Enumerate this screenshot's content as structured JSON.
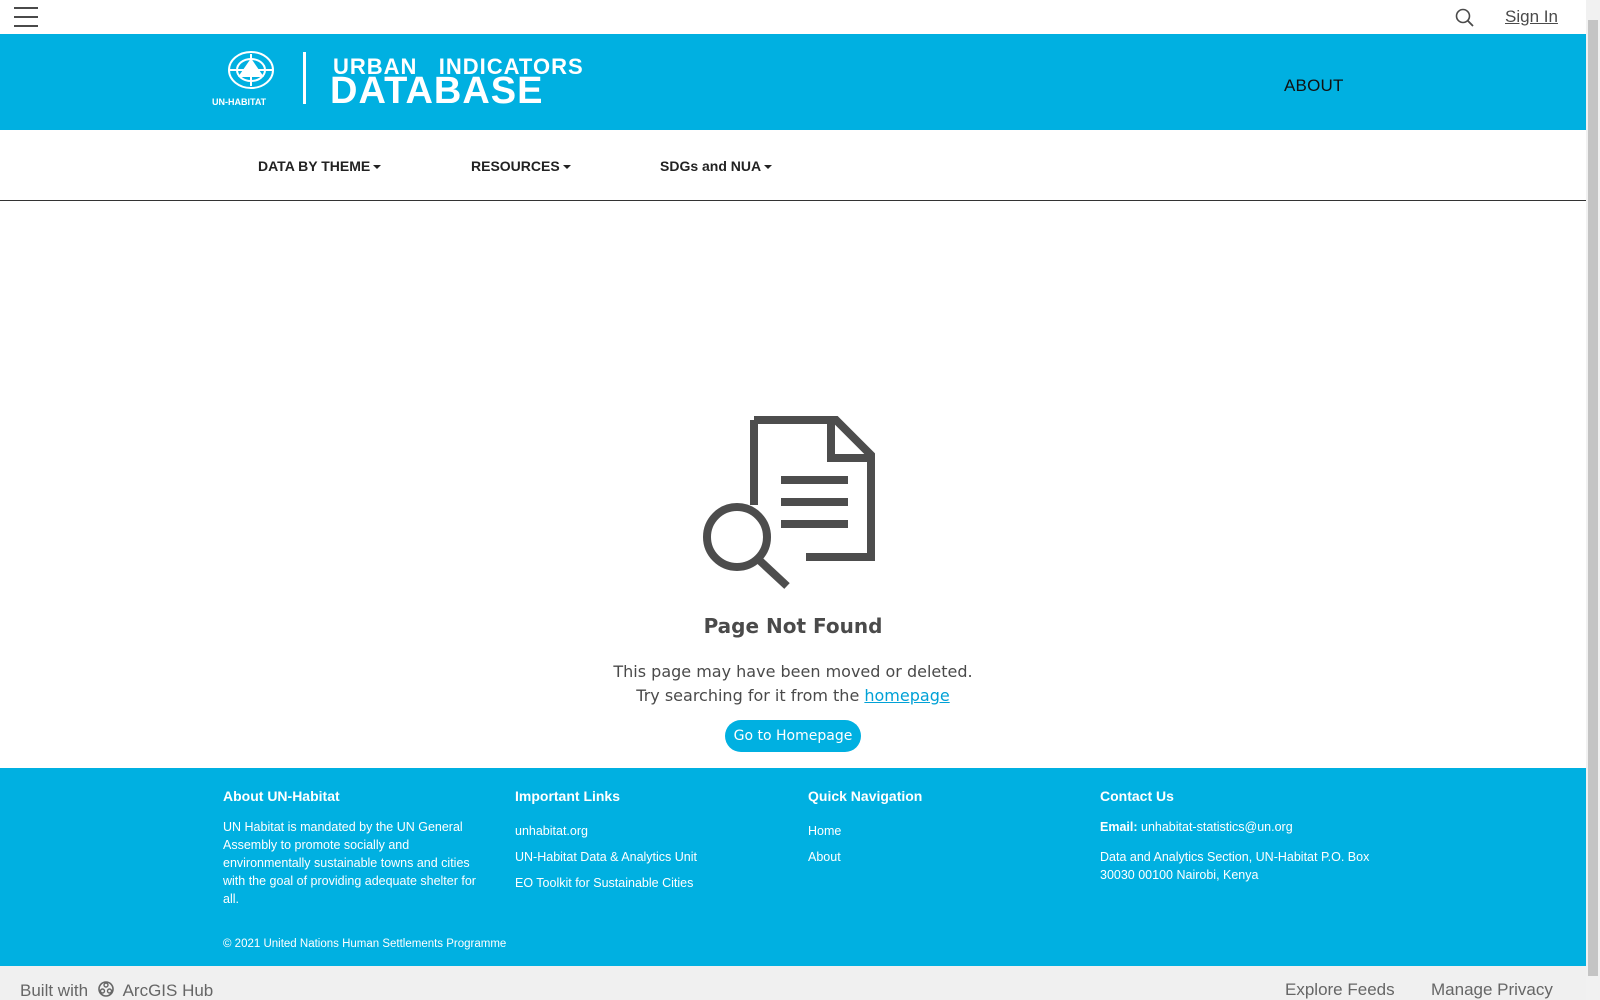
{
  "topbar": {
    "menu_icon": "hamburger-menu-icon",
    "search_icon": "search-icon",
    "sign_in_label": "Sign In"
  },
  "banner": {
    "logo_org": "UN-HABITAT",
    "logo_line1": "URBAN   INDICATORS",
    "logo_line2": "DATABASE",
    "about_label": "ABOUT",
    "bg_color": "#00b0e1"
  },
  "navbar": {
    "items": [
      {
        "label": "DATA BY THEME"
      },
      {
        "label": "RESOURCES"
      },
      {
        "label": "SDGs and NUA"
      }
    ]
  },
  "not_found": {
    "icon": "document-search-icon",
    "title": "Page Not Found",
    "line1": "This page may have been moved or deleted.",
    "line2_prefix": "Try searching for it from the ",
    "line2_link": "homepage",
    "button_label": "Go to Homepage"
  },
  "footer": {
    "about": {
      "heading": "About UN-Habitat",
      "text": "UN Habitat is mandated by the UN General Assembly to promote socially and environmentally sustainable towns and cities with the goal of providing adequate shelter for all."
    },
    "links": {
      "heading": "Important Links",
      "items": [
        "unhabitat.org",
        "UN-Habitat Data & Analytics Unit",
        "EO Toolkit for Sustainable Cities"
      ]
    },
    "quicknav": {
      "heading": "Quick Navigation",
      "items": [
        "Home",
        "About"
      ]
    },
    "contact": {
      "heading": "Contact Us",
      "email_label": "Email:",
      "email": "unhabitat-statistics@un.org",
      "address": "Data and Analytics Section, UN-Habitat P.O. Box 30030 00100 Nairobi, Kenya"
    },
    "copyright": "© 2021 United Nations Human Settlements Programme"
  },
  "hubbar": {
    "built_prefix": "Built with",
    "hub_name": "ArcGIS Hub",
    "explore_label": "Explore Feeds",
    "privacy_label": "Manage Privacy"
  }
}
